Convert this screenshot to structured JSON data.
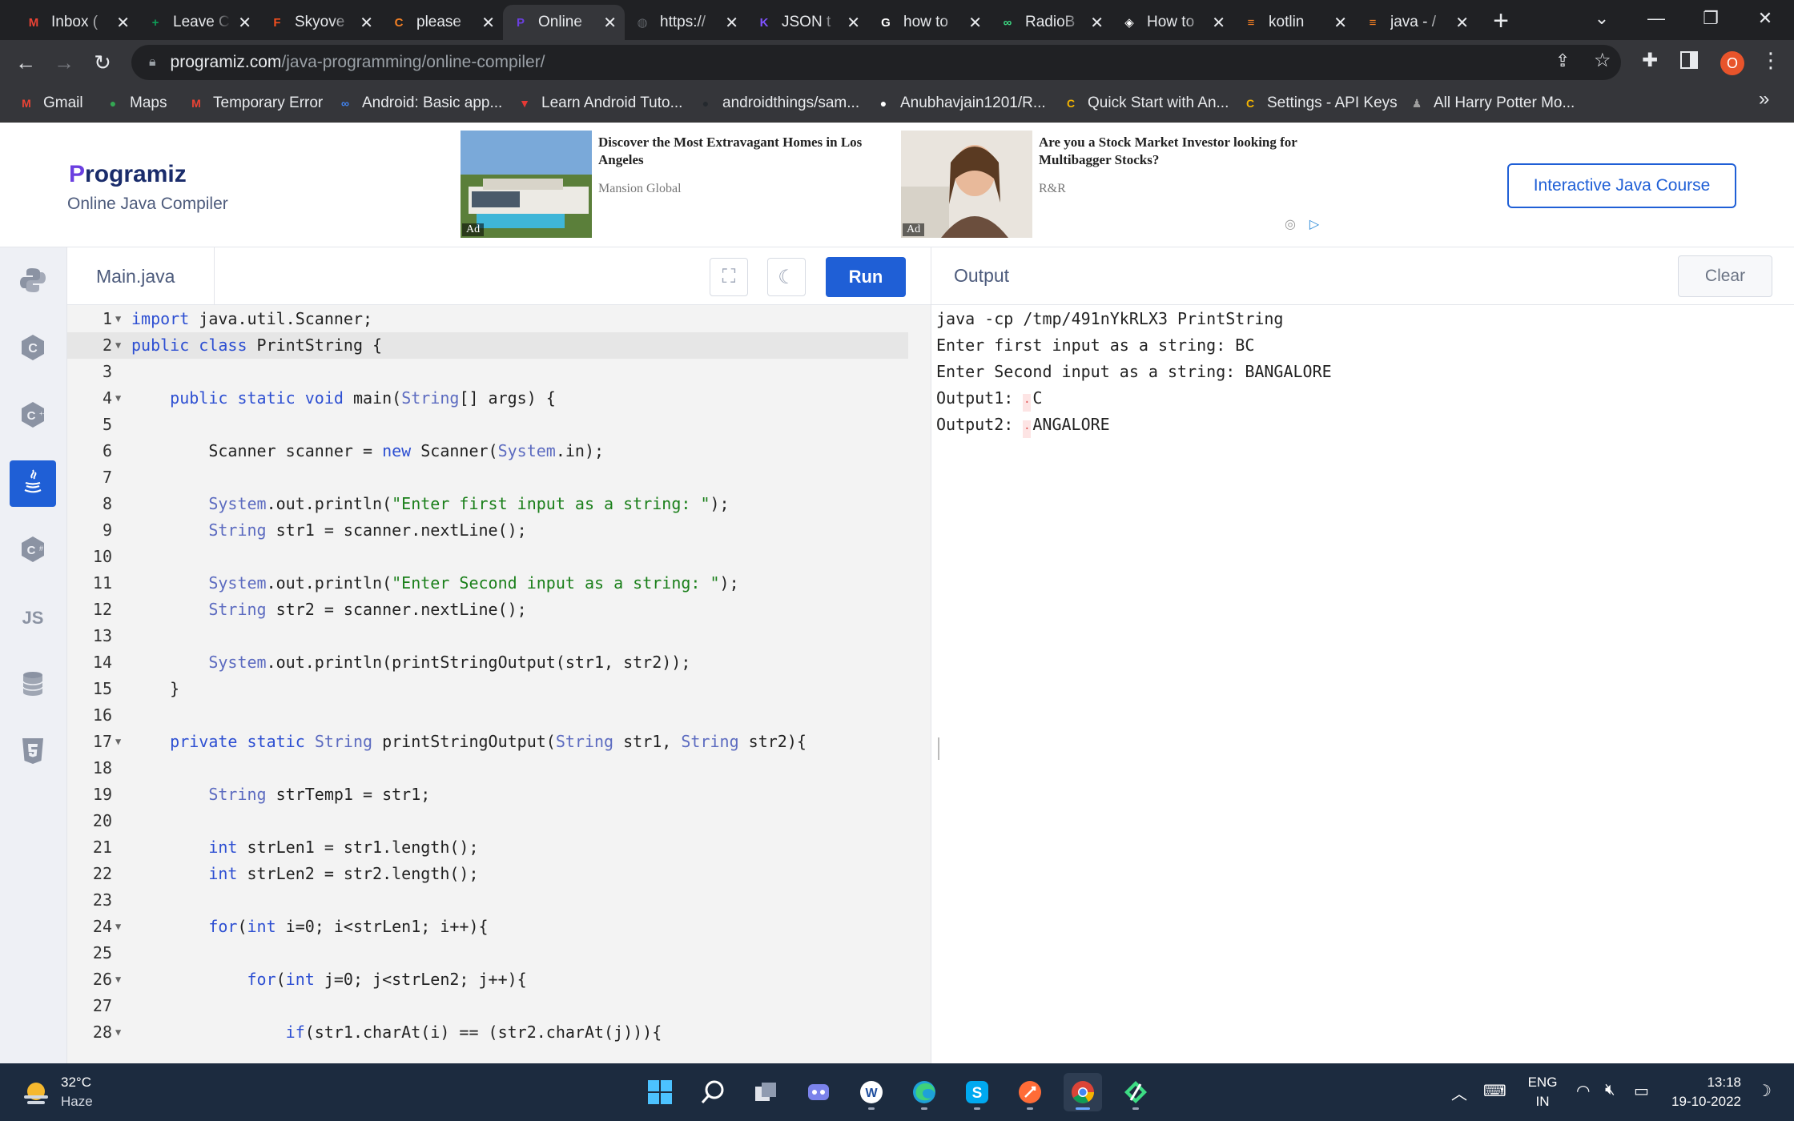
{
  "browser": {
    "tabs": [
      {
        "label": "Inbox (",
        "icon": "gmail-icon",
        "color": "#ea4335",
        "glyph": "M"
      },
      {
        "label": "Leave C",
        "icon": "sheets-icon",
        "color": "#0f9d58",
        "glyph": "+"
      },
      {
        "label": "Skyove",
        "icon": "figma-icon",
        "color": "#f24e1e",
        "glyph": "F"
      },
      {
        "label": "please",
        "icon": "c-logo-icon",
        "color": "#f48024",
        "glyph": "C"
      },
      {
        "label": "Online",
        "icon": "programiz-icon",
        "color": "#6b3fe0",
        "glyph": "P"
      },
      {
        "label": "https://",
        "icon": "globe-icon",
        "color": "#5f6368",
        "glyph": "◍"
      },
      {
        "label": "JSON t",
        "icon": "kotlin-icon",
        "color": "#7f52ff",
        "glyph": "K"
      },
      {
        "label": "how to",
        "icon": "google-icon",
        "color": "#ffffff",
        "glyph": "G"
      },
      {
        "label": "RadioB",
        "icon": "android-link-icon",
        "color": "#3ddc84",
        "glyph": "∞"
      },
      {
        "label": "How to",
        "icon": "diamond-icon",
        "color": "#ffffff",
        "glyph": "◈"
      },
      {
        "label": "kotlin",
        "icon": "stackoverflow-icon",
        "color": "#f48024",
        "glyph": "≡"
      },
      {
        "label": "java - /",
        "icon": "stackoverflow-icon",
        "color": "#f48024",
        "glyph": "≡"
      }
    ],
    "active_tab": 4,
    "url_host": "programiz.com",
    "url_path": "/java-programming/online-compiler/",
    "profile_initial": "O",
    "bookmarks": [
      {
        "label": "Gmail",
        "icon": "gmail-icon",
        "color": "#ea4335",
        "glyph": "M"
      },
      {
        "label": "Maps",
        "icon": "maps-pin-icon",
        "color": "#34a853",
        "glyph": "●"
      },
      {
        "label": "Temporary Error",
        "icon": "gmail-icon",
        "color": "#ea4335",
        "glyph": "M"
      },
      {
        "label": "Android: Basic app...",
        "icon": "infinity-icon",
        "color": "#4285f4",
        "glyph": "∞"
      },
      {
        "label": "Learn Android Tuto...",
        "icon": "tutorial-icon",
        "color": "#e53935",
        "glyph": "▼"
      },
      {
        "label": "androidthings/sam...",
        "icon": "github-icon",
        "color": "#24292e",
        "glyph": "●"
      },
      {
        "label": "Anubhavjain1201/R...",
        "icon": "github-icon",
        "color": "#ffffff",
        "glyph": "●"
      },
      {
        "label": "Quick Start with An...",
        "icon": "c-logo-icon",
        "color": "#f4b400",
        "glyph": "C"
      },
      {
        "label": "Settings - API Keys",
        "icon": "c-logo-icon",
        "color": "#f4b400",
        "glyph": "C"
      },
      {
        "label": "All Harry Potter Mo...",
        "icon": "wizard-icon",
        "color": "#9e9e9e",
        "glyph": "♟"
      }
    ]
  },
  "header": {
    "logo_first": "P",
    "logo_rest": "rogramiz",
    "subtitle": "Online Java Compiler",
    "ads": [
      {
        "title": "Discover the Most Extravagant Homes in Los Angeles",
        "source": "Mansion Global",
        "tag": "Ad"
      },
      {
        "title": "Are you a Stock Market Investor looking for Multibagger Stocks?",
        "source": "R&R",
        "tag": "Ad"
      }
    ],
    "course_button": "Interactive Java Course"
  },
  "sidebar": {
    "items": [
      {
        "name": "python",
        "icon": "python-icon",
        "text": ""
      },
      {
        "name": "c",
        "icon": "c-icon",
        "text": ""
      },
      {
        "name": "cpp",
        "icon": "cpp-icon",
        "text": ""
      },
      {
        "name": "java",
        "icon": "java-icon",
        "text": ""
      },
      {
        "name": "csharp",
        "icon": "csharp-icon",
        "text": ""
      },
      {
        "name": "javascript",
        "icon": "js-icon",
        "text": "JS"
      },
      {
        "name": "sql",
        "icon": "database-icon",
        "text": ""
      },
      {
        "name": "html",
        "icon": "html5-icon",
        "text": ""
      }
    ],
    "active": 3
  },
  "editor": {
    "file_name": "Main.java",
    "run_label": "Run",
    "current_line": 2,
    "lines": [
      {
        "n": "1",
        "fold": true,
        "html": "<span class=\"kw\">import</span> java.util.Scanner;"
      },
      {
        "n": "2",
        "fold": true,
        "html": "<span class=\"kw\">public</span> <span class=\"kw\">class</span> PrintString {"
      },
      {
        "n": "3",
        "fold": false,
        "html": ""
      },
      {
        "n": "4",
        "fold": true,
        "html": "    <span class=\"kw\">public</span> <span class=\"kw\">static</span> <span class=\"kw\">void</span> main(<span class=\"ty\">String</span>[] args) {"
      },
      {
        "n": "5",
        "fold": false,
        "html": ""
      },
      {
        "n": "6",
        "fold": false,
        "html": "        Scanner scanner = <span class=\"kw\">new</span> Scanner(<span class=\"ty\">System</span>.in);"
      },
      {
        "n": "7",
        "fold": false,
        "html": ""
      },
      {
        "n": "8",
        "fold": false,
        "html": "        <span class=\"ty\">System</span>.out.println(<span class=\"st\">\"Enter first input as a string: \"</span>);"
      },
      {
        "n": "9",
        "fold": false,
        "html": "        <span class=\"ty\">String</span> str1 = scanner.nextLine();"
      },
      {
        "n": "10",
        "fold": false,
        "html": ""
      },
      {
        "n": "11",
        "fold": false,
        "html": "        <span class=\"ty\">System</span>.out.println(<span class=\"st\">\"Enter Second input as a string: \"</span>);"
      },
      {
        "n": "12",
        "fold": false,
        "html": "        <span class=\"ty\">String</span> str2 = scanner.nextLine();"
      },
      {
        "n": "13",
        "fold": false,
        "html": ""
      },
      {
        "n": "14",
        "fold": false,
        "html": "        <span class=\"ty\">System</span>.out.println(printStringOutput(str1, str2));"
      },
      {
        "n": "15",
        "fold": false,
        "html": "    }"
      },
      {
        "n": "16",
        "fold": false,
        "html": ""
      },
      {
        "n": "17",
        "fold": true,
        "html": "    <span class=\"kw\">private</span> <span class=\"kw\">static</span> <span class=\"ty\">String</span> printStringOutput(<span class=\"ty\">String</span> str1, <span class=\"ty\">String</span> str2){"
      },
      {
        "n": "18",
        "fold": false,
        "html": ""
      },
      {
        "n": "19",
        "fold": false,
        "html": "        <span class=\"ty\">String</span> strTemp1 = str1;"
      },
      {
        "n": "20",
        "fold": false,
        "html": ""
      },
      {
        "n": "21",
        "fold": false,
        "html": "        <span class=\"kw\">int</span> strLen1 = str1.length();"
      },
      {
        "n": "22",
        "fold": false,
        "html": "        <span class=\"kw\">int</span> strLen2 = str2.length();"
      },
      {
        "n": "23",
        "fold": false,
        "html": ""
      },
      {
        "n": "24",
        "fold": true,
        "html": "        <span class=\"kw\">for</span>(<span class=\"kw\">int</span> i=0; i&lt;strLen1; i++){"
      },
      {
        "n": "25",
        "fold": false,
        "html": ""
      },
      {
        "n": "26",
        "fold": true,
        "html": "            <span class=\"kw\">for</span>(<span class=\"kw\">int</span> j=0; j&lt;strLen2; j++){"
      },
      {
        "n": "27",
        "fold": false,
        "html": ""
      },
      {
        "n": "28",
        "fold": true,
        "html": "                <span class=\"kw\">if</span>(str1.charAt(i) == (str2.charAt(j))){"
      }
    ]
  },
  "output": {
    "title": "Output",
    "clear_label": "Clear",
    "lines": [
      {
        "text": "java -cp /tmp/491nYkRLX3 PrintString",
        "marker": false,
        "prefix": ""
      },
      {
        "text": "Enter first input as a string: BC",
        "marker": false,
        "prefix": ""
      },
      {
        "text": "Enter Second input as a string: BANGALORE",
        "marker": false,
        "prefix": ""
      },
      {
        "text": "C",
        "marker": true,
        "prefix": "Output1: "
      },
      {
        "text": "ANGALORE",
        "marker": true,
        "prefix": "Output2: "
      }
    ]
  },
  "taskbar": {
    "temperature": "32°C",
    "condition": "Haze",
    "language": "ENG",
    "region": "IN",
    "time": "13:18",
    "date": "19-10-2022",
    "apps": [
      {
        "name": "start",
        "icon": "windows-start-icon",
        "active": false
      },
      {
        "name": "search",
        "icon": "search-icon",
        "active": false
      },
      {
        "name": "task-view",
        "icon": "task-view-icon",
        "active": false
      },
      {
        "name": "teams",
        "icon": "teams-chat-icon",
        "active": false
      },
      {
        "name": "word",
        "icon": "word-icon",
        "active": false
      },
      {
        "name": "edge",
        "icon": "edge-icon",
        "active": false
      },
      {
        "name": "skype",
        "icon": "skype-icon",
        "active": false
      },
      {
        "name": "postman",
        "icon": "postman-icon",
        "active": false
      },
      {
        "name": "chrome",
        "icon": "chrome-icon",
        "active": true
      },
      {
        "name": "android-studio",
        "icon": "android-studio-icon",
        "active": false
      }
    ]
  }
}
